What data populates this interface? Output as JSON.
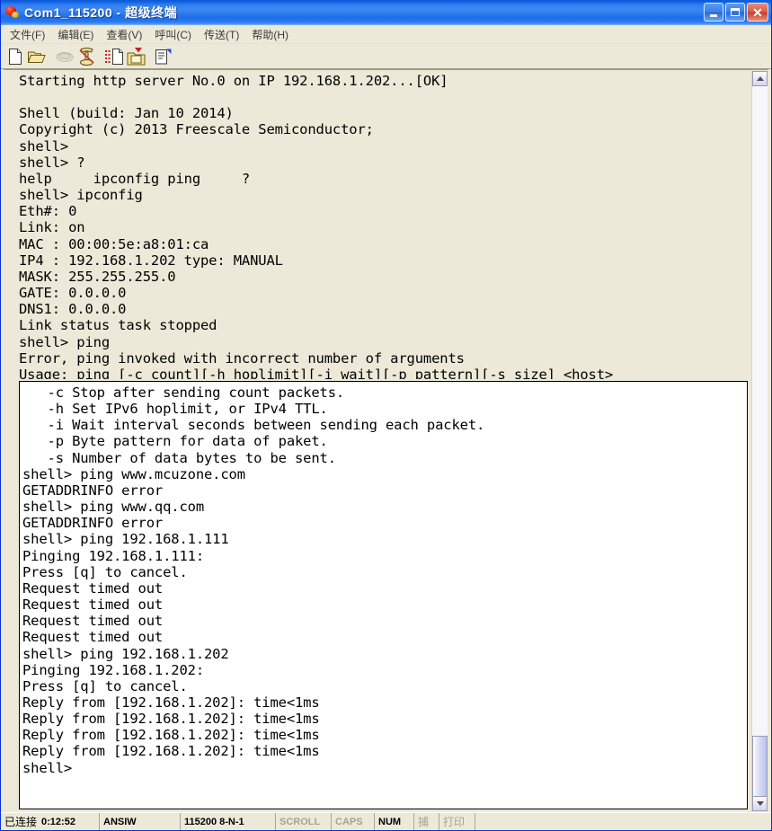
{
  "window": {
    "title": "Com1_115200 - 超级终端",
    "icon": "hyperterminal-icon",
    "caption_buttons": [
      {
        "name": "minimize-button",
        "glyph": "_"
      },
      {
        "name": "maximize-button",
        "glyph": "□"
      },
      {
        "name": "close-button",
        "glyph": "✕"
      }
    ]
  },
  "menubar": {
    "items": [
      {
        "label": "文件(F)",
        "name": "menu-file"
      },
      {
        "label": "编辑(E)",
        "name": "menu-edit"
      },
      {
        "label": "查看(V)",
        "name": "menu-view"
      },
      {
        "label": "呼叫(C)",
        "name": "menu-call"
      },
      {
        "label": "传送(T)",
        "name": "menu-transfer"
      },
      {
        "label": "帮助(H)",
        "name": "menu-help"
      }
    ]
  },
  "toolbar": {
    "buttons": [
      {
        "name": "new-connection-icon",
        "title": "新建连接"
      },
      {
        "name": "open-file-icon",
        "title": "打开"
      },
      {
        "name": "disconnect-phone-icon",
        "title": "断开",
        "disabled": true
      },
      {
        "name": "call-phone-icon",
        "title": "呼叫"
      },
      {
        "name": "send-file-icon",
        "title": "发送"
      },
      {
        "name": "receive-file-icon",
        "title": "接收"
      },
      {
        "name": "properties-icon",
        "title": "属性"
      }
    ]
  },
  "terminal": {
    "top_lines": [
      "Starting http server No.0 on IP 192.168.1.202...[OK]",
      "",
      "Shell (build: Jan 10 2014)",
      "Copyright (c) 2013 Freescale Semiconductor;",
      "shell>",
      "shell> ?",
      "help     ipconfig ping     ?",
      "shell> ipconfig",
      "Eth#: 0",
      "Link: on",
      "MAC : 00:00:5e:a8:01:ca",
      "IP4 : 192.168.1.202 type: MANUAL",
      "MASK: 255.255.255.0",
      "GATE: 0.0.0.0",
      "DNS1: 0.0.0.0",
      "Link status task stopped",
      "shell> ping",
      "Error, ping invoked with incorrect number of arguments",
      "Usage: ping [-c count][-h hoplimit][-i wait][-p pattern][-s size] <host>"
    ],
    "bottom_lines": [
      "   -c Stop after sending count packets.",
      "   -h Set IPv6 hoplimit, or IPv4 TTL.",
      "   -i Wait interval seconds between sending each packet.",
      "   -p Byte pattern for data of paket.",
      "   -s Number of data bytes to be sent.",
      "shell> ping www.mcuzone.com",
      "GETADDRINFO error",
      "shell> ping www.qq.com",
      "GETADDRINFO error",
      "shell> ping 192.168.1.111",
      "Pinging 192.168.1.111:",
      "Press [q] to cancel.",
      "Request timed out",
      "Request timed out",
      "Request timed out",
      "Request timed out",
      "shell> ping 192.168.1.202",
      "Pinging 192.168.1.202:",
      "Press [q] to cancel.",
      "Reply from [192.168.1.202]: time<1ms",
      "Reply from [192.168.1.202]: time<1ms",
      "Reply from [192.168.1.202]: time<1ms",
      "Reply from [192.168.1.202]: time<1ms",
      "shell>"
    ]
  },
  "scrollbar": {
    "up_arrow": "scroll-up-icon",
    "down_arrow": "scroll-down-icon"
  },
  "statusbar": {
    "connected_label": "已连接",
    "connected_time": "0:12:52",
    "emulation": "ANSIW",
    "line_settings": "115200 8-N-1",
    "scroll": "SCROLL",
    "caps": "CAPS",
    "num": "NUM",
    "capture": "捕",
    "print": "打印"
  },
  "colors": {
    "title_blue": "#0a5ad8",
    "face": "#ece9d8",
    "terminal_bg": "#ece9d8",
    "console_bg": "#ffffff",
    "text": "#000000",
    "dim_text": "#a6a395",
    "border_blue": "#0831d9"
  }
}
